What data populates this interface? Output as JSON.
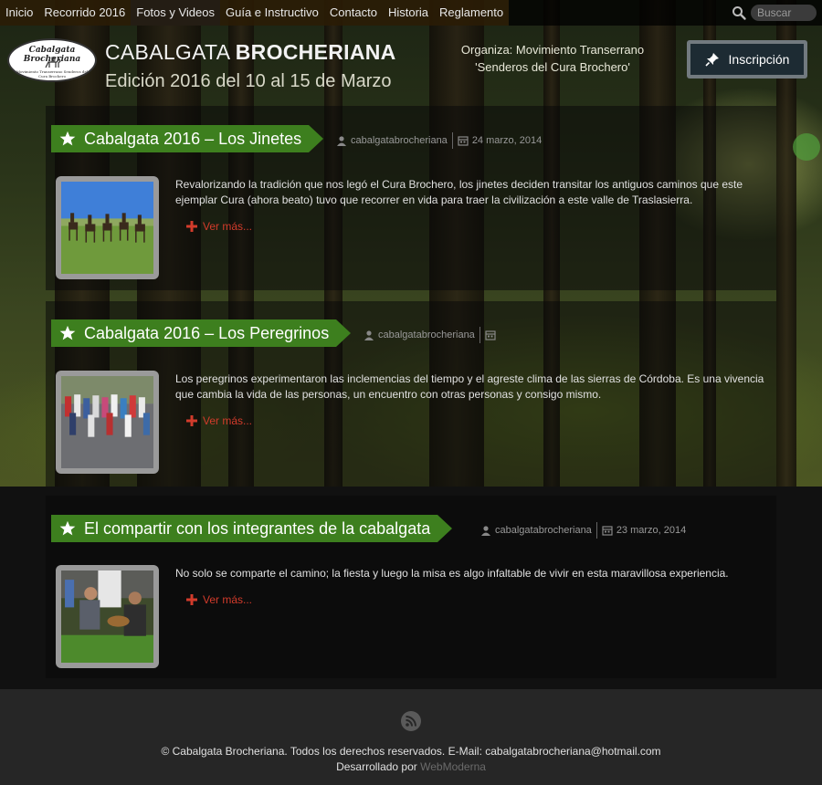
{
  "nav": {
    "items": [
      {
        "label": "Inicio"
      },
      {
        "label": "Recorrido 2016"
      },
      {
        "label": "Fotos y Videos"
      },
      {
        "label": "Guía e Instructivo"
      },
      {
        "label": "Contacto"
      },
      {
        "label": "Historia"
      },
      {
        "label": "Reglamento"
      }
    ],
    "active_index": 2,
    "search_placeholder": "Buscar"
  },
  "header": {
    "logo_text": "Cabalgata Brocheriana",
    "logo_subtext": "Movimiento Transerrano Senderos del Cura Brochero",
    "title_light": "CABALGATA ",
    "title_bold": "BROCHERIANA",
    "subtitle": "Edición 2016 del 10 al 15 de Marzo",
    "organiza_line1": "Organiza: Movimiento Transerrano",
    "organiza_line2": "'Senderos del Cura Brochero'",
    "inscripcion_label": "Inscripción"
  },
  "posts": [
    {
      "title": "Cabalgata 2016 – Los Jinetes",
      "author": "cabalgatabrocheriana",
      "date": "24 marzo, 2014",
      "excerpt": "Revalorizando la tradición que nos legó el Cura Brochero, los jinetes deciden transitar los antiguos caminos que este ejemplar Cura (ahora beato) tuvo que recorrer en vida para traer la civilización a este valle de Traslasierra.",
      "readmore": "Ver más..."
    },
    {
      "title": "Cabalgata 2016 – Los Peregrinos",
      "author": "cabalgatabrocheriana",
      "date": "",
      "excerpt": "Los peregrinos experimentaron las inclemencias del tiempo y el agreste clima de las sierras de Córdoba. Es una vivencia que cambia la vida de las personas, un encuentro con otras personas y consigo mismo.",
      "readmore": "Ver más..."
    },
    {
      "title": "El compartir con los integrantes de la cabalgata",
      "author": "cabalgatabrocheriana",
      "date": "23 marzo, 2014",
      "excerpt": "No solo se comparte el camino; la fiesta y luego la misa es algo infaltable de vivir en esta maravillosa experiencia.",
      "readmore": "Ver más..."
    }
  ],
  "footer": {
    "copyright": "© Cabalgata Brocheriana. Todos los derechos reservados. E-Mail: cabalgatabrocheriana@hotmail.com",
    "developed_prefix": "Desarrollado por ",
    "developed_link": "WebModerna"
  },
  "colors": {
    "title_bar_green": "#3d7f1e",
    "readmore_red": "#d23b2b",
    "inscripcion_bg": "#1d2b33"
  },
  "icons": [
    "search-icon",
    "star-icon",
    "user-icon",
    "calendar-icon",
    "plus-icon",
    "rss-icon",
    "pin-icon"
  ]
}
